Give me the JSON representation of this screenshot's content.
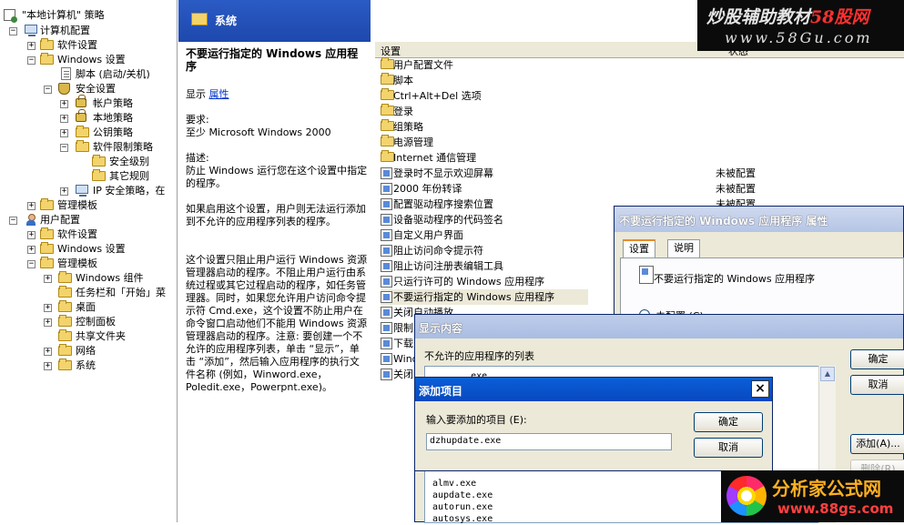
{
  "tree": {
    "root": "\"本地计算机\" 策略",
    "items": [
      {
        "label": "计算机配置"
      },
      {
        "label": "软件设置"
      },
      {
        "label": "Windows 设置"
      },
      {
        "label": "脚本 (启动/关机)"
      },
      {
        "label": "安全设置"
      },
      {
        "label": "帐户策略"
      },
      {
        "label": "本地策略"
      },
      {
        "label": "公钥策略"
      },
      {
        "label": "软件限制策略"
      },
      {
        "label": "安全级别"
      },
      {
        "label": "其它规则"
      },
      {
        "label": "IP 安全策略，在"
      },
      {
        "label": "管理模板"
      },
      {
        "label": "用户配置"
      },
      {
        "label": "软件设置"
      },
      {
        "label": "Windows 设置"
      },
      {
        "label": "管理模板"
      },
      {
        "label": "Windows 组件"
      },
      {
        "label": "任务栏和「开始」菜"
      },
      {
        "label": "桌面"
      },
      {
        "label": "控制面板"
      },
      {
        "label": "共享文件夹"
      },
      {
        "label": "网络"
      },
      {
        "label": "系统"
      }
    ]
  },
  "desc": {
    "header": "系统",
    "policy_title": "不要运行指定的 Windows 应用程序",
    "show_label": "显示",
    "show_link": "属性",
    "req_label": "要求:",
    "req_value": "至少 Microsoft Windows 2000",
    "desc_label": "描述:",
    "desc_p1": "防止 Windows 运行您在这个设置中指定的程序。",
    "desc_p2": "如果启用这个设置，用户则无法运行添加到不允许的应用程序列表的程序。",
    "desc_p3": "这个设置只阻止用户运行 Windows 资源管理器启动的程序。不阻止用户运行由系统过程或其它过程启动的程序，如任务管理器。同时，如果您允许用户访问命令提示符 Cmd.exe，这个设置不防止用户在命令窗口启动他们不能用 Windows 资源管理器启动的程序。注意: 要创建一个不允许的应用程序列表，单击 “显示”，单击 “添加”，然后输入应用程序的执行文件名称 (例如，Winword.exe，Poledit.exe，Powerpnt.exe)。"
  },
  "list": {
    "col_setting": "设置",
    "col_state": "状态",
    "rows": [
      {
        "label": "用户配置文件",
        "kind": "folder",
        "state": ""
      },
      {
        "label": "脚本",
        "kind": "folder",
        "state": ""
      },
      {
        "label": "Ctrl+Alt+Del 选项",
        "kind": "folder",
        "state": ""
      },
      {
        "label": "登录",
        "kind": "folder",
        "state": ""
      },
      {
        "label": "组策略",
        "kind": "folder",
        "state": ""
      },
      {
        "label": "电源管理",
        "kind": "folder",
        "state": ""
      },
      {
        "label": "Internet 通信管理",
        "kind": "folder",
        "state": ""
      },
      {
        "label": "登录时不显示欢迎屏幕",
        "kind": "setting",
        "state": "未被配置"
      },
      {
        "label": "2000 年份转译",
        "kind": "setting",
        "state": "未被配置"
      },
      {
        "label": "配置驱动程序搜索位置",
        "kind": "setting",
        "state": "未被配置"
      },
      {
        "label": "设备驱动程序的代码签名",
        "kind": "setting",
        "state": ""
      },
      {
        "label": "自定义用户界面",
        "kind": "setting",
        "state": ""
      },
      {
        "label": "阻止访问命令提示符",
        "kind": "setting",
        "state": ""
      },
      {
        "label": "阻止访问注册表编辑工具",
        "kind": "setting",
        "state": ""
      },
      {
        "label": "只运行许可的 Windows 应用程序",
        "kind": "setting",
        "state": ""
      },
      {
        "label": "不要运行指定的 Windows 应用程序",
        "kind": "setting",
        "state": ""
      },
      {
        "label": "关闭自动播放",
        "kind": "setting",
        "state": ""
      },
      {
        "label": "限制",
        "kind": "setting",
        "state": ""
      },
      {
        "label": "下载",
        "kind": "setting",
        "state": ""
      },
      {
        "label": "Wind",
        "kind": "setting",
        "state": ""
      },
      {
        "label": "关闭",
        "kind": "setting",
        "state": ""
      }
    ]
  },
  "props": {
    "title": "不要运行指定的 Windows 应用程序 属性",
    "tab_setting": "设置",
    "tab_explain": "说明",
    "policy_name": "不要运行指定的 Windows 应用程序",
    "radio_unconfigured": "未配置 (C)"
  },
  "show": {
    "title": "显示内容",
    "list_label": "不允许的应用程序的列表",
    "ok": "确定",
    "cancel": "取消",
    "add": "添加(A)...",
    "remove": "删除(R)",
    "items": [
      "... .exe",
      "almv.exe",
      "aupdate.exe",
      "autorun.exe",
      "autosys.exe"
    ]
  },
  "add": {
    "title": "添加项目",
    "prompt": "输入要添加的项目 (E):",
    "value": "dzhupdate.exe",
    "ok": "确定",
    "cancel": "取消",
    "close": "×"
  },
  "watermarks": {
    "top_line1a": "炒股辅助教材",
    "top_line1b": "58股网",
    "top_line2": "www.58Gu.com",
    "bottom_line1": "分析家公式网",
    "bottom_line2": "www.88gs.com"
  }
}
